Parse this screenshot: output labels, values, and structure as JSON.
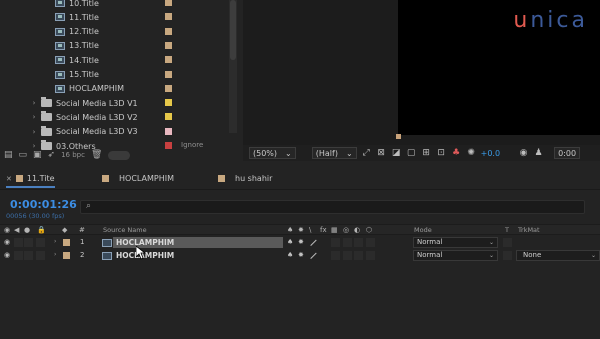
{
  "brand": {
    "u": "u",
    "rest": "nica",
    "u_color": "#e25a50",
    "rest_color": "#3c5a99"
  },
  "project": {
    "items": [
      {
        "type": "comp",
        "name": "10.Title",
        "color": "#c8a880"
      },
      {
        "type": "comp",
        "name": "11.Title",
        "color": "#c8a880"
      },
      {
        "type": "comp",
        "name": "12.Title",
        "color": "#c8a880"
      },
      {
        "type": "comp",
        "name": "13.Title",
        "color": "#c8a880"
      },
      {
        "type": "comp",
        "name": "14.Title",
        "color": "#c8a880"
      },
      {
        "type": "comp",
        "name": "15.Title",
        "color": "#c8a880"
      },
      {
        "type": "comp",
        "name": "HOCLAMPHIM",
        "color": "#c8a880"
      },
      {
        "type": "folder",
        "name": "Social Media L3D V1",
        "color": "#e6c84a"
      },
      {
        "type": "folder",
        "name": "Social Media L3D V2",
        "color": "#e6c84a"
      },
      {
        "type": "folder",
        "name": "Social Media L3D V3",
        "color": "#e8b8c0"
      },
      {
        "type": "folder",
        "name": "03.Others",
        "color": "#c84040"
      }
    ],
    "ignore_label": "Ignore",
    "bpc": "16 bpc"
  },
  "viewer_toolbar": {
    "magnification": "(50%)",
    "resolution": "(Half)",
    "exposure": "+0.0",
    "time_partial": "0:00"
  },
  "tabs": [
    {
      "label": "11.Tite",
      "color": "#c8a880",
      "active": true
    },
    {
      "label": "HOCLAMPHIM",
      "color": "#c8a880",
      "active": false
    },
    {
      "label": "hu shahir",
      "color": "#c8a880",
      "active": false
    }
  ],
  "timeline": {
    "timecode": "0:00:01:26",
    "frames": "00056 (30.00 fps)",
    "search_placeholder": "",
    "header": {
      "source_name": "Source Name",
      "mode": "Mode",
      "t": "T",
      "trkmat": "TrkMat"
    },
    "layers": [
      {
        "num": "1",
        "name": "HOCLAMPHIM",
        "label_color": "#c8a880",
        "mode": "Normal",
        "trkmat": "",
        "selected": true
      },
      {
        "num": "2",
        "name": "HOCLAMPHIM",
        "label_color": "#c8a880",
        "mode": "Normal",
        "trkmat": "None",
        "selected": false
      }
    ]
  }
}
